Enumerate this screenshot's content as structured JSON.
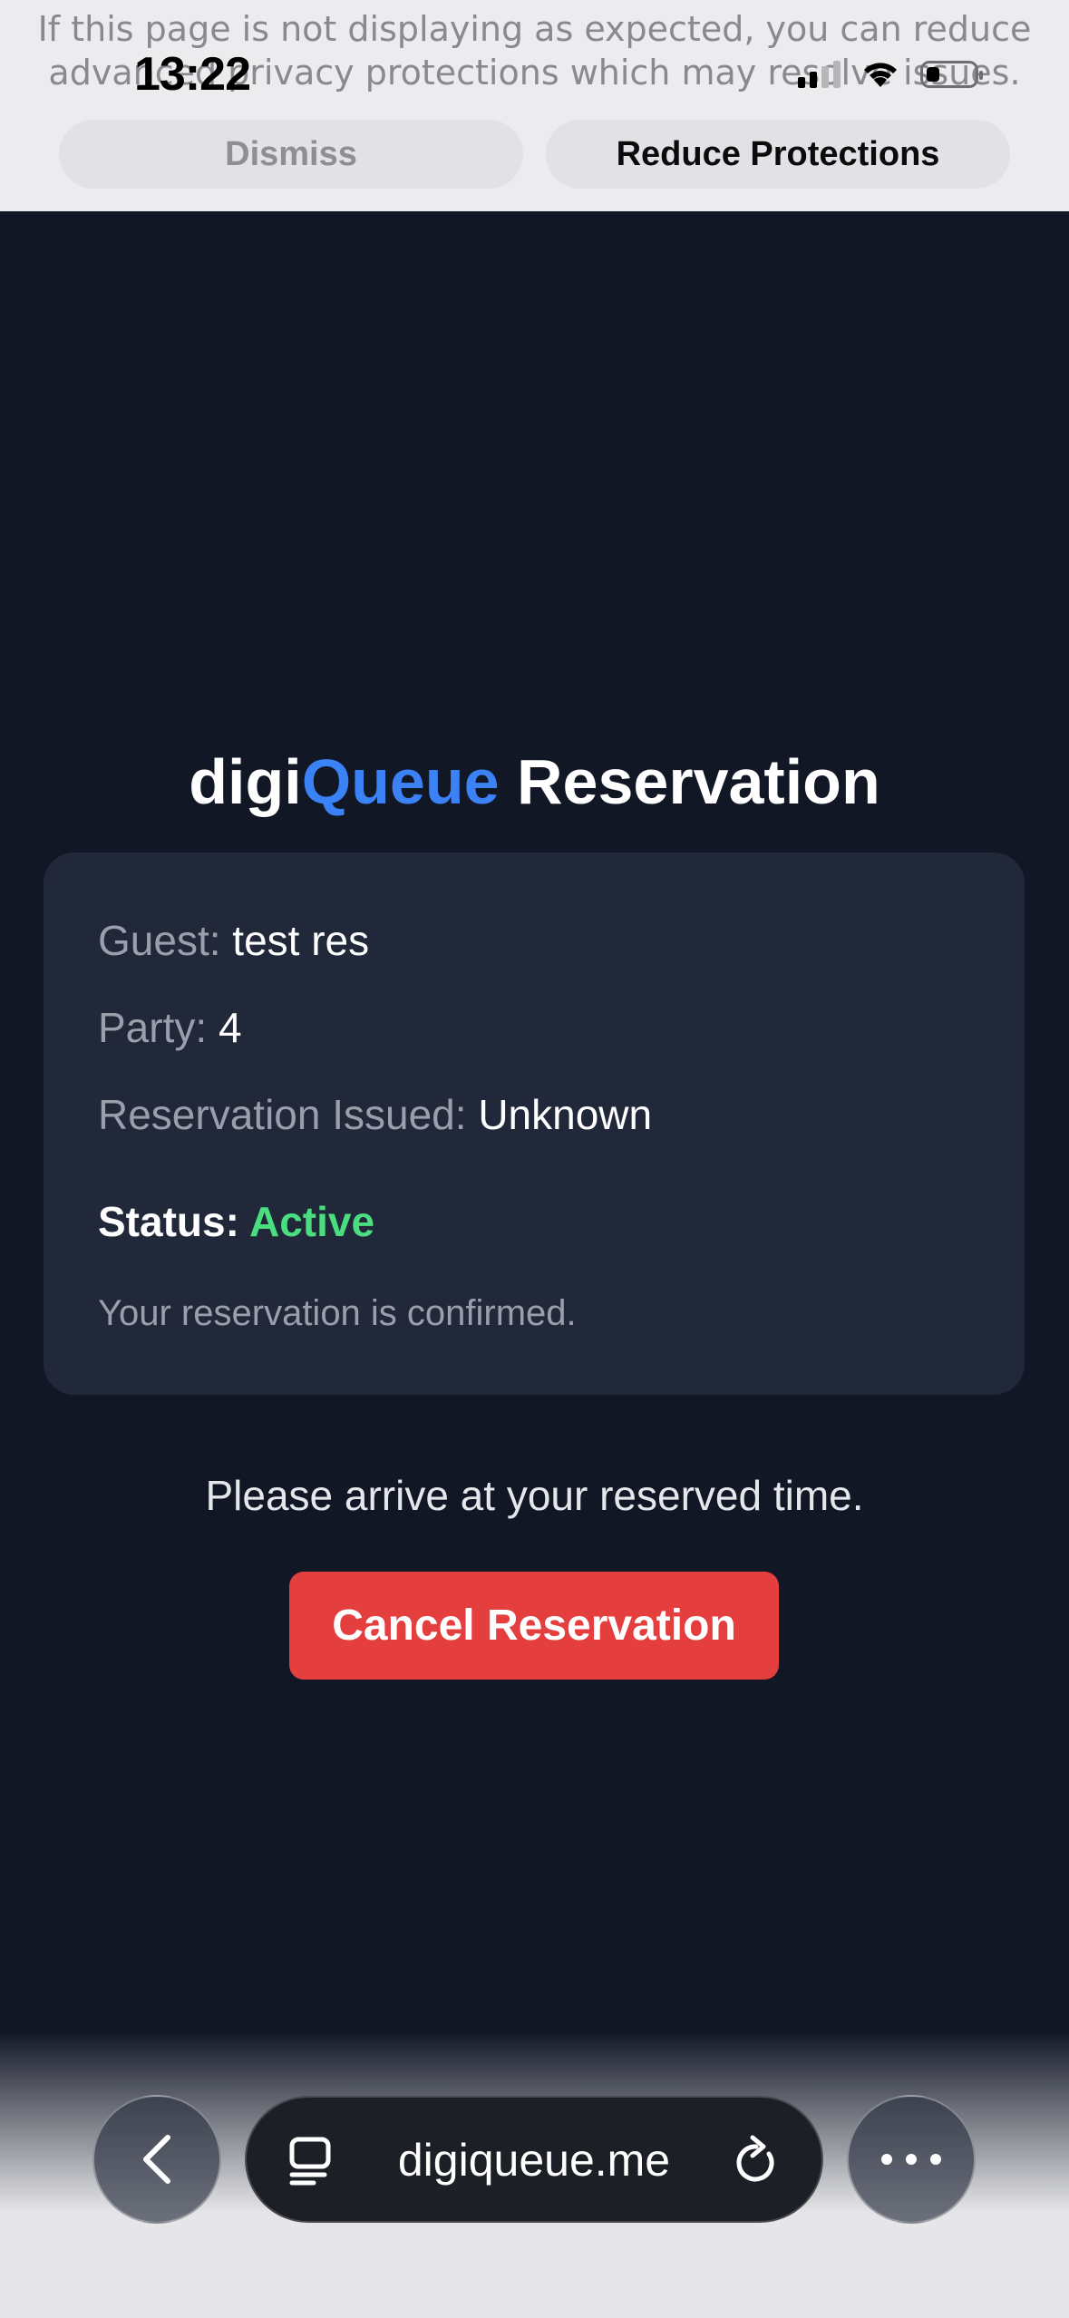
{
  "banner": {
    "text_line1": "If this page is not displaying as expected, you can reduce",
    "text_line2": "advanced privacy protections which may resolve issues.",
    "dismiss_label": "Dismiss",
    "reduce_label": "Reduce Protections"
  },
  "status_bar": {
    "time": "13:22",
    "signal_bars_active": 2,
    "icons": [
      "cellular-signal-icon",
      "wifi-icon",
      "battery-icon"
    ]
  },
  "page": {
    "title_prefix": "digi",
    "title_accent": "Queue",
    "title_suffix": " Reservation",
    "guest_label": "Guest:",
    "guest_value": "test res",
    "party_label": "Party:",
    "party_value": "4",
    "issued_label": "Reservation Issued:",
    "issued_value": "Unknown",
    "status_label": "Status:",
    "status_value": "Active",
    "confirmation": "Your reservation is confirmed.",
    "arrive_message": "Please arrive at your reserved time.",
    "cancel_label": "Cancel Reservation"
  },
  "browser": {
    "url": "digiqueue.me",
    "icons": [
      "back-chevron-icon",
      "tabs-icon",
      "reload-icon",
      "more-icon"
    ]
  },
  "colors": {
    "background": "#121726",
    "card": "#212839",
    "accent_blue": "#3b82f6",
    "status_green": "#4ade80",
    "cancel_red": "#e53e3e"
  }
}
